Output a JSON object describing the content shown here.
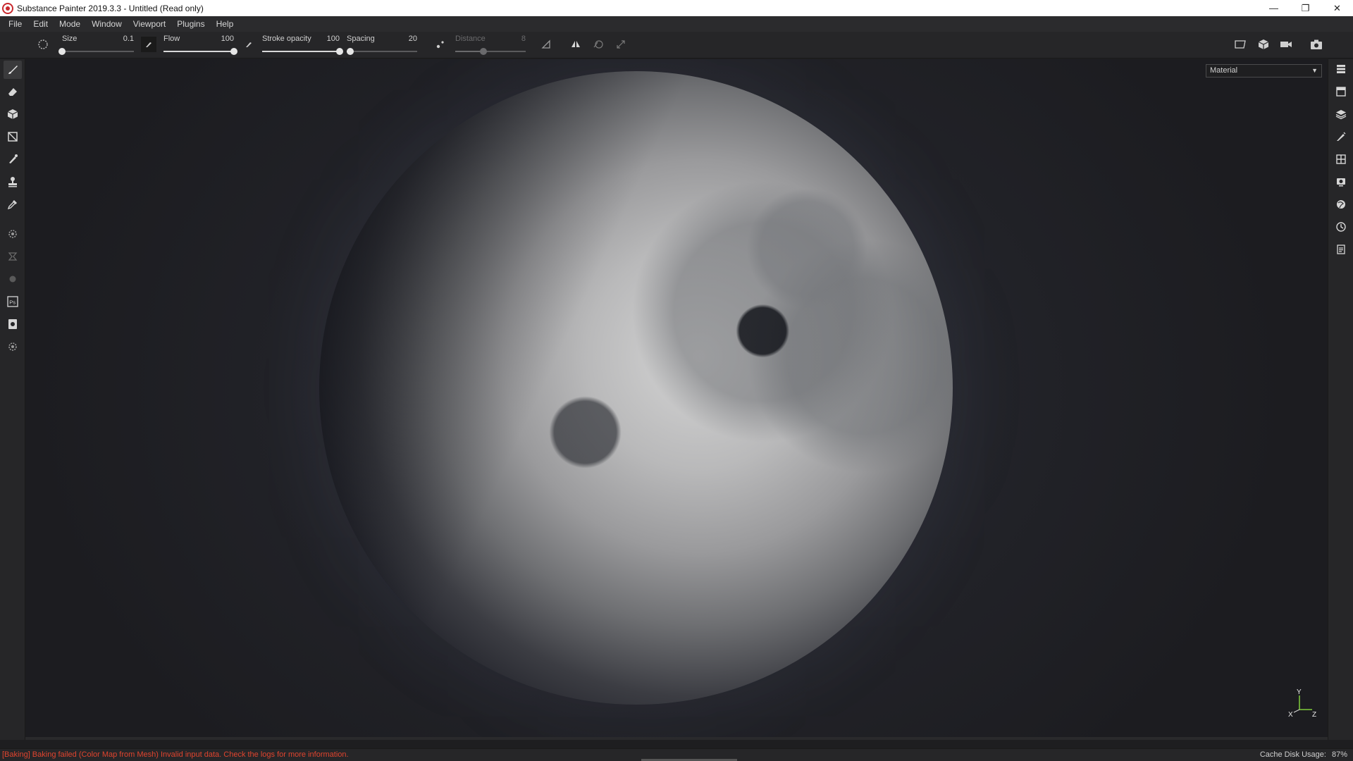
{
  "window": {
    "title": "Substance Painter 2019.3.3 - Untitled (Read only)",
    "controls": [
      "minimize-icon",
      "restore-icon",
      "close-icon"
    ]
  },
  "menu": [
    "File",
    "Edit",
    "Mode",
    "Window",
    "Viewport",
    "Plugins",
    "Help"
  ],
  "toolbar": {
    "size": {
      "label": "Size",
      "value": "0.1",
      "fraction": 0.0
    },
    "flow": {
      "label": "Flow",
      "value": "100",
      "fraction": 1.0
    },
    "stroke_opacity": {
      "label": "Stroke opacity",
      "value": "100",
      "fraction": 1.0
    },
    "spacing": {
      "label": "Spacing",
      "value": "20",
      "fraction": 0.05
    },
    "distance": {
      "label": "Distance",
      "value": "8",
      "fraction": 0.4,
      "disabled": true
    }
  },
  "left_tools": [
    "paint-brush-icon",
    "eraser-icon",
    "projection-icon",
    "polygon-fill-icon",
    "smudge-icon",
    "clone-stamp-icon",
    "color-picker-icon",
    "settings-icon",
    "bake-icon",
    "plugin-icon",
    "photoshop-icon",
    "export-icon",
    "resource-icon"
  ],
  "right_tools": [
    "layers-list-icon",
    "texture-set-icon",
    "layer-stack-icon",
    "brush-properties-icon",
    "display-settings-icon",
    "camera-settings-icon",
    "shelf-icon",
    "history-icon",
    "log-icon"
  ],
  "viewport": {
    "channel_select": "Material",
    "axis": {
      "x": "X",
      "y": "Y",
      "z": "Z"
    }
  },
  "status": {
    "message": "[Baking] Baking failed (Color Map from Mesh) Invalid input data. Check the logs for more information.",
    "cache_label": "Cache Disk Usage:",
    "cache_value": "87%"
  },
  "colors": {
    "error": "#e0442e",
    "panel": "#262628",
    "accent": "#c8282d"
  }
}
